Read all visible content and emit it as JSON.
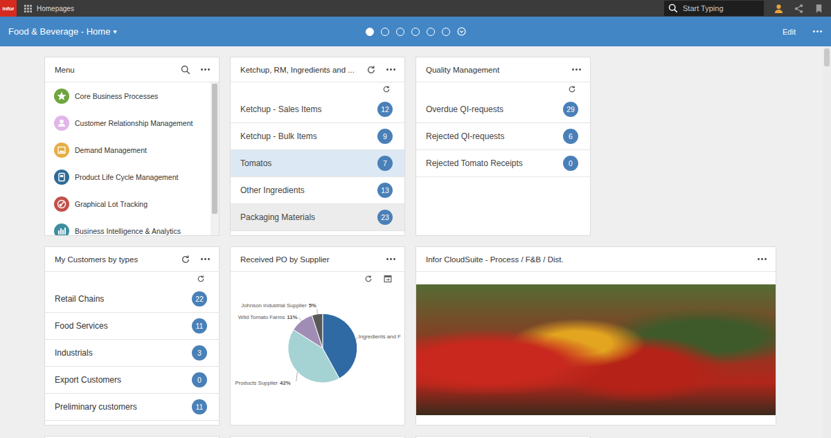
{
  "topbar": {
    "logo": "infor",
    "app": "Homepages",
    "search_placeholder": "Start Typing"
  },
  "header": {
    "title": "Food & Beverage - Home",
    "caret": "▾",
    "pages": [
      {
        "selected": true
      },
      {
        "selected": false
      },
      {
        "selected": false
      },
      {
        "selected": false
      },
      {
        "selected": false
      },
      {
        "selected": false
      }
    ],
    "edit": "Edit"
  },
  "menu": {
    "title": "Menu",
    "scroll_level": 0.85,
    "items": [
      {
        "label": "Core Business Processes",
        "color": "#6fa53f"
      },
      {
        "label": "Customer Relationship Management",
        "color": "#e2b4ea"
      },
      {
        "label": "Demand Management",
        "color": "#e6ae45"
      },
      {
        "label": "Product Life Cycle Management",
        "color": "#2f6b98"
      },
      {
        "label": "Graphical Lot Tracking",
        "color": "#c2504a"
      },
      {
        "label": "Business Intelligence & Analytics",
        "color": "#3e8ea0"
      }
    ]
  },
  "ketchup": {
    "title": "Ketchup, RM, Ingredients and ...",
    "items": [
      {
        "label": "Ketchup - Sales Items",
        "count": "12",
        "selected": false,
        "hovered": false
      },
      {
        "label": "Ketchup - Bulk Items",
        "count": "9",
        "selected": false,
        "hovered": false
      },
      {
        "label": "Tomatos",
        "count": "7",
        "selected": true,
        "hovered": false
      },
      {
        "label": "Other Ingredients",
        "count": "13",
        "selected": false,
        "hovered": false
      },
      {
        "label": "Packaging Materials",
        "count": "23",
        "selected": false,
        "hovered": true
      }
    ]
  },
  "quality": {
    "title": "Quality Management",
    "items": [
      {
        "label": "Overdue QI-requests",
        "count": "29",
        "selected": false,
        "hovered": false
      },
      {
        "label": "Rejected QI-requests",
        "count": "6",
        "selected": false,
        "hovered": false
      },
      {
        "label": "Rejected Tomato Receipts",
        "count": "0",
        "selected": false,
        "hovered": false
      }
    ]
  },
  "customers": {
    "title": "My Customers by types",
    "items": [
      {
        "label": "Retail Chains",
        "count": "22",
        "selected": false,
        "hovered": false
      },
      {
        "label": "Food Services",
        "count": "11",
        "selected": false,
        "hovered": false
      },
      {
        "label": "Industrials",
        "count": "3",
        "selected": false,
        "hovered": false
      },
      {
        "label": "Export Customers",
        "count": "0",
        "selected": false,
        "hovered": false
      },
      {
        "label": "Preliminary customers",
        "count": "11",
        "selected": false,
        "hovered": false
      }
    ]
  },
  "po_chart": {
    "title": "Received PO by Supplier",
    "slices": [
      {
        "label": "Ingredients and F",
        "pct": "",
        "value": 42,
        "color": "#2f6aa5"
      },
      {
        "label": "Products Supplier",
        "pct": "42%",
        "value": 42,
        "color": "#a5d2d3"
      },
      {
        "label": "Wild Tomato Farms",
        "pct": "11%",
        "value": 11,
        "color": "#a08db5"
      },
      {
        "label": "Johnson Industrial Supplier",
        "pct": "5%",
        "value": 5,
        "color": "#585858"
      }
    ]
  },
  "image_card": {
    "title": "Infor CloudSuite - Process / F&B / Dist."
  }
}
